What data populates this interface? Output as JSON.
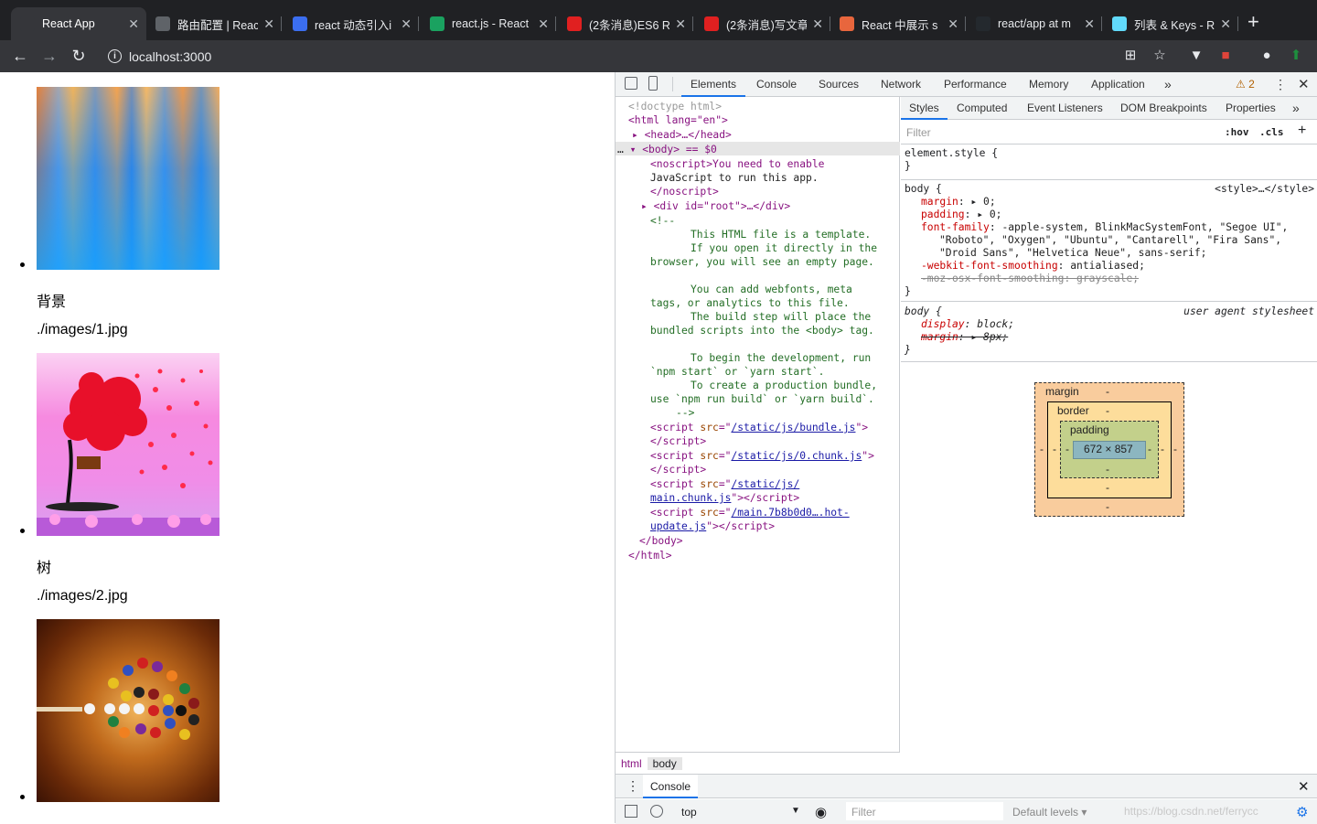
{
  "browser": {
    "tabs": [
      {
        "title": "React App",
        "favicon": "document-icon",
        "color": "#35363a",
        "active": true
      },
      {
        "title": "路由配置 | React",
        "favicon": "book-icon",
        "color": "#5f6368",
        "active": false
      },
      {
        "title": "react 动态引入i",
        "favicon": "paw-icon",
        "color": "#3b6ef0",
        "active": false
      },
      {
        "title": "react.js - React",
        "favicon": "sf-icon",
        "color": "#1aa260",
        "active": false
      },
      {
        "title": "(2条消息)ES6 R",
        "favicon": "csdn-icon",
        "color": "#e02020",
        "active": false
      },
      {
        "title": "(2条消息)写文章",
        "favicon": "csdn-icon",
        "color": "#e02020",
        "active": false
      },
      {
        "title": "React 中展示 s",
        "favicon": "jian-icon",
        "color": "#e8663d",
        "active": false
      },
      {
        "title": "react/app at m",
        "favicon": "github-icon",
        "color": "#24292e",
        "active": false
      },
      {
        "title": "列表 & Keys - R",
        "favicon": "react-icon",
        "color": "#61dafb",
        "active": false
      }
    ],
    "url": "localhost:3000"
  },
  "page": {
    "items": [
      {
        "label": "背景",
        "path": "./images/1.jpg"
      },
      {
        "label": "树",
        "path": "./images/2.jpg"
      },
      {
        "label": "",
        "path": ""
      }
    ]
  },
  "devtools": {
    "tabs": [
      "Elements",
      "Console",
      "Sources",
      "Network",
      "Performance",
      "Memory",
      "Application"
    ],
    "selected_tab": "Elements",
    "warning_count": "2",
    "dom_lines": [
      "<!doctype html>",
      "<html lang=\"en\">",
      "<head>…</head>",
      "<body> == $0",
      "<noscript>You need to enable",
      "JavaScript to run this app.",
      "</noscript>",
      "<div id=\"root\">…</div>",
      "<!--",
      "This HTML file is a template.",
      "If you open it directly in the",
      "browser, you will see an empty page.",
      "You can add webfonts, meta",
      "tags, or analytics to this file.",
      "The build step will place the",
      "bundled scripts into the <body> tag.",
      "To begin the development, run",
      "`npm start` or `yarn start`.",
      "To create a production bundle,",
      "use `npm run build` or `yarn build`.",
      "-->",
      "/static/js/bundle.js",
      "/static/js/0.chunk.js",
      "/static/js/",
      "main.chunk.js",
      "/main.7b8b0d0….hot-",
      "update.js",
      "</body>",
      "</html>"
    ],
    "breadcrumbs": [
      "html",
      "body"
    ],
    "side_tabs": [
      "Styles",
      "Computed",
      "Event Listeners",
      "DOM Breakpoints",
      "Properties"
    ],
    "filter_placeholder": "Filter",
    "hov": ":hov",
    "cls": ".cls",
    "styles": {
      "element_style": "element.style {",
      "rule1_selector": "body {",
      "rule1_source": "<style>…</style>",
      "rule1_props": [
        {
          "name": "margin",
          "value": "0;"
        },
        {
          "name": "padding",
          "value": "0;"
        },
        {
          "name": "font-family",
          "value": "-apple-system, BlinkMacSystemFont, \"Segoe UI\","
        },
        {
          "name": "",
          "value": "\"Roboto\", \"Oxygen\", \"Ubuntu\", \"Cantarell\", \"Fira Sans\","
        },
        {
          "name": "",
          "value": "\"Droid Sans\", \"Helvetica Neue\", sans-serif;"
        },
        {
          "name": "-webkit-font-smoothing",
          "value": "antialiased;"
        },
        {
          "name": "-moz-osx-font-smoothing",
          "value": "grayscale;"
        }
      ],
      "rule2_selector": "body {",
      "rule2_source": "user agent stylesheet",
      "rule2_props": [
        {
          "name": "display",
          "value": "block;"
        },
        {
          "name": "margin",
          "value": "8px;"
        }
      ]
    },
    "box_model": {
      "margin": "margin",
      "border": "border",
      "padding": "padding",
      "dash": "-",
      "content": "672 × 857"
    },
    "console": {
      "title": "Console",
      "context": "top",
      "filter_placeholder": "Filter",
      "levels": "Default levels ▾",
      "watermark": "https://blog.csdn.net/ferrycc"
    }
  }
}
